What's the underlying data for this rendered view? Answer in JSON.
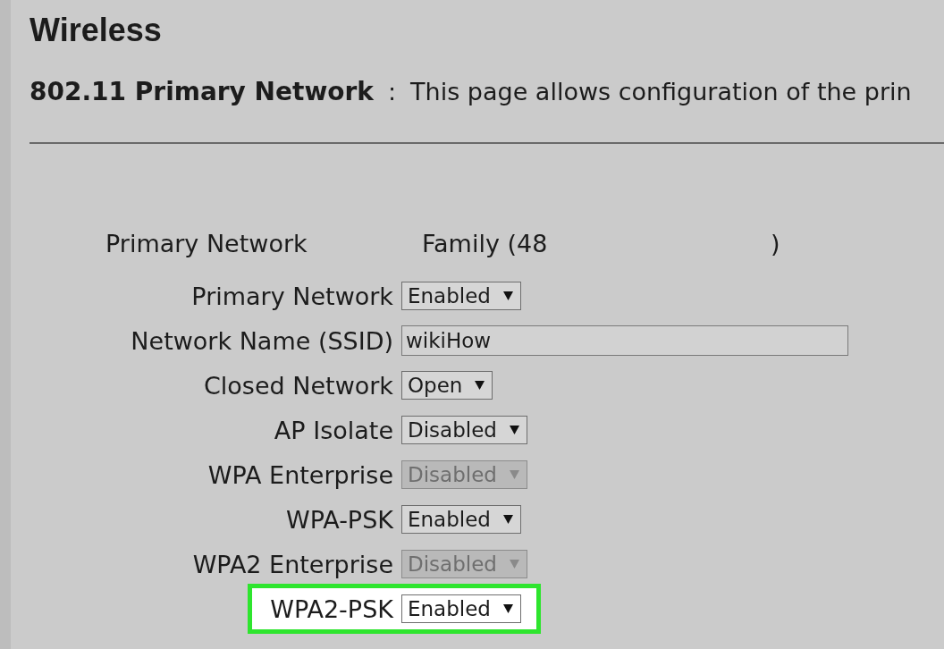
{
  "title": "Wireless",
  "intro": {
    "heading": "802.11 Primary Network",
    "separator": ":",
    "text": "This page allows configuration of the prin"
  },
  "info": {
    "label": "Primary Network",
    "value": "Family (48",
    "suffix": ")"
  },
  "fields": [
    {
      "kind": "select",
      "label": "Primary Network",
      "value": "Enabled",
      "disabled": false,
      "highlighted": false
    },
    {
      "kind": "text",
      "label": "Network Name (SSID)",
      "value": "wikiHow",
      "disabled": false,
      "highlighted": false
    },
    {
      "kind": "select",
      "label": "Closed Network",
      "value": "Open",
      "disabled": false,
      "highlighted": false
    },
    {
      "kind": "select",
      "label": "AP Isolate",
      "value": "Disabled",
      "disabled": false,
      "highlighted": false
    },
    {
      "kind": "select",
      "label": "WPA Enterprise",
      "value": "Disabled",
      "disabled": true,
      "highlighted": false
    },
    {
      "kind": "select",
      "label": "WPA-PSK",
      "value": "Enabled",
      "disabled": false,
      "highlighted": false
    },
    {
      "kind": "select",
      "label": "WPA2 Enterprise",
      "value": "Disabled",
      "disabled": true,
      "highlighted": false
    },
    {
      "kind": "select",
      "label": "WPA2-PSK",
      "value": "Enabled",
      "disabled": false,
      "highlighted": true
    }
  ]
}
